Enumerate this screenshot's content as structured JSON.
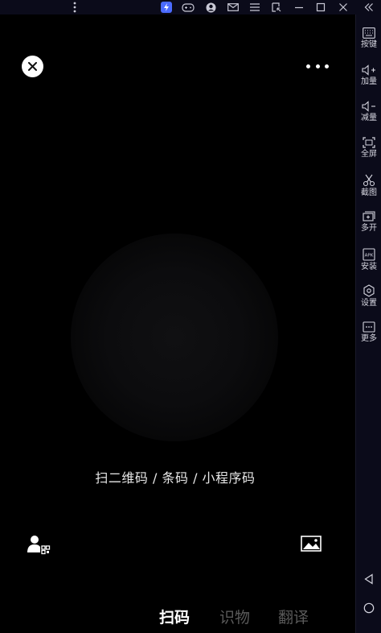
{
  "sidebar": {
    "items": [
      {
        "label": "按键",
        "icon": "keyboard-icon"
      },
      {
        "label": "加量",
        "icon": "volume-up-icon"
      },
      {
        "label": "减量",
        "icon": "volume-down-icon"
      },
      {
        "label": "全屏",
        "icon": "fullscreen-icon"
      },
      {
        "label": "截图",
        "icon": "scissors-icon"
      },
      {
        "label": "多开",
        "icon": "multi-instance-icon"
      },
      {
        "label": "安装",
        "icon": "apk-icon"
      },
      {
        "label": "设置",
        "icon": "settings-icon"
      },
      {
        "label": "更多",
        "icon": "more-icon"
      }
    ]
  },
  "scanner": {
    "hint": "扫二维码 / 条码 / 小程序码"
  },
  "tabs": [
    {
      "label": "扫码",
      "active": true
    },
    {
      "label": "识物",
      "active": false
    },
    {
      "label": "翻译",
      "active": false
    }
  ],
  "colors": {
    "background": "#000000",
    "chrome": "#0b0b1a",
    "brand": "#4b6bff",
    "inactive_tab": "#5a5a5a"
  }
}
